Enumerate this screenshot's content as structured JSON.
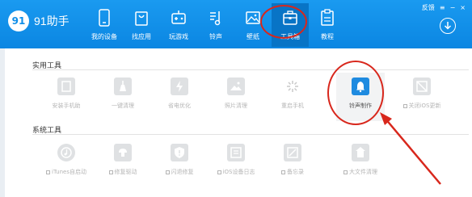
{
  "app": {
    "logo_badge": "91",
    "logo_text": "91助手",
    "accent_color": "#1a9af0",
    "highlight_color": "#d8271c"
  },
  "window_controls": {
    "feedback": "反馈",
    "menu": "≡",
    "minimize": "−",
    "close": "×"
  },
  "nav": {
    "items": [
      {
        "label": "我的设备",
        "icon": "phone-icon"
      },
      {
        "label": "找应用",
        "icon": "bag-icon"
      },
      {
        "label": "玩游戏",
        "icon": "gamepad-icon"
      },
      {
        "label": "铃声",
        "icon": "music-icon"
      },
      {
        "label": "壁纸",
        "icon": "image-icon"
      },
      {
        "label": "工具箱",
        "icon": "toolbox-icon",
        "active": true
      },
      {
        "label": "教程",
        "icon": "tutorial-icon"
      }
    ]
  },
  "sections": {
    "practical": {
      "title": "实用工具",
      "tools": [
        {
          "label": "安装手机助",
          "icon": "install-icon"
        },
        {
          "label": "一键清理",
          "icon": "clean-icon"
        },
        {
          "label": "省电优化",
          "icon": "power-icon"
        },
        {
          "label": "照片清理",
          "icon": "photo-icon"
        },
        {
          "label": "重启手机",
          "icon": "restart-icon"
        },
        {
          "label": "铃声制作",
          "icon": "ringtone-icon",
          "featured": true
        },
        {
          "label": "关闭iOS更新",
          "icon": "ios-update-icon"
        }
      ]
    },
    "system": {
      "title": "系统工具",
      "tools": [
        {
          "label": "iTunes自启动",
          "icon": "itunes-icon"
        },
        {
          "label": "修复驱动",
          "icon": "driver-icon"
        },
        {
          "label": "闪退修复",
          "icon": "shield-icon"
        },
        {
          "label": "iOS设备日志",
          "icon": "log-icon"
        },
        {
          "label": "备忘录",
          "icon": "memo-icon"
        },
        {
          "label": "大文件清理",
          "icon": "bigfile-icon"
        }
      ]
    }
  }
}
